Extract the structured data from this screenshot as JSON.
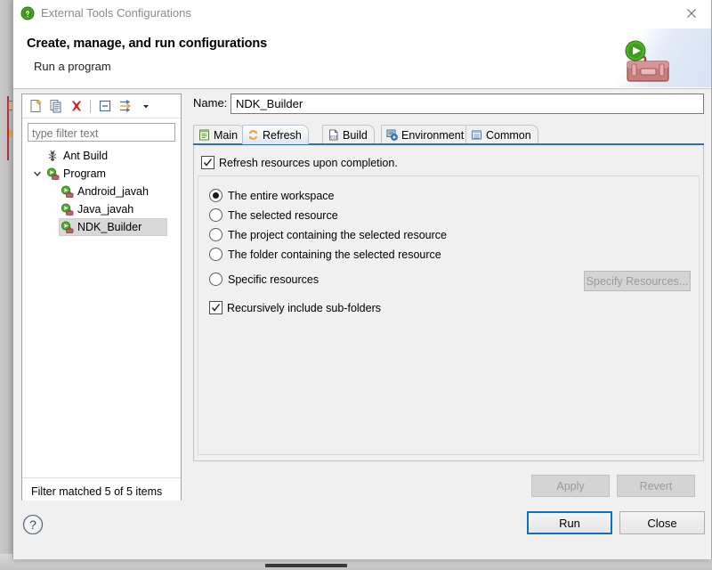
{
  "window": {
    "title": "External Tools Configurations",
    "title_icon": "eclipse-run-icon",
    "close_icon": "close-icon"
  },
  "header": {
    "title": "Create, manage, and run configurations",
    "subtitle": "Run a program",
    "art_icon": "toolbox-with-run-icon"
  },
  "left_panel": {
    "toolbar": [
      {
        "name": "new-configuration-icon",
        "tooltip": "New launch configuration"
      },
      {
        "name": "duplicate-configuration-icon",
        "tooltip": "Duplicate"
      },
      {
        "name": "delete-configuration-icon",
        "tooltip": "Delete"
      },
      {
        "name": "collapse-all-icon",
        "tooltip": "Collapse All"
      },
      {
        "name": "filter-icon",
        "tooltip": "Filter launch configurations"
      },
      {
        "name": "chevron-down-icon",
        "tooltip": "Menu"
      }
    ],
    "filter": {
      "value": "",
      "placeholder": "type filter text"
    },
    "tree": [
      {
        "label": "Ant Build",
        "level": 0,
        "icon": "ant-build-icon",
        "expandable": false,
        "expanded": false,
        "selected": false
      },
      {
        "label": "Program",
        "level": 0,
        "icon": "program-run-icon",
        "expandable": true,
        "expanded": true,
        "selected": false
      },
      {
        "label": "Android_javah",
        "level": 1,
        "icon": "program-run-icon",
        "expandable": false,
        "expanded": false,
        "selected": false
      },
      {
        "label": "Java_javah",
        "level": 1,
        "icon": "program-run-icon",
        "expandable": false,
        "expanded": false,
        "selected": false
      },
      {
        "label": "NDK_Builder",
        "level": 1,
        "icon": "program-run-icon",
        "expandable": false,
        "expanded": false,
        "selected": true
      }
    ],
    "status": "Filter matched 5 of 5 items"
  },
  "right_panel": {
    "name_label": "Name:",
    "name_value": "NDK_Builder",
    "tabs": [
      {
        "label": "Main",
        "icon": "main-tab-icon",
        "active": false
      },
      {
        "label": "Refresh",
        "icon": "refresh-tab-icon",
        "active": true
      },
      {
        "label": "Build",
        "icon": "build-tab-icon",
        "active": false
      },
      {
        "label": "Environment",
        "icon": "environment-tab-icon",
        "active": false
      },
      {
        "label": "Common",
        "icon": "common-tab-icon",
        "active": false
      }
    ],
    "refresh_tab": {
      "enable_checkbox": {
        "label": "Refresh resources upon completion.",
        "checked": true
      },
      "scope_options": [
        {
          "label": "The entire workspace",
          "selected": true
        },
        {
          "label": "The selected resource",
          "selected": false
        },
        {
          "label": "The project containing the selected resource",
          "selected": false
        },
        {
          "label": "The folder containing the selected resource",
          "selected": false
        },
        {
          "label": "Specific resources",
          "selected": false
        }
      ],
      "specify_button": {
        "label": "Specify Resources...",
        "enabled": false
      },
      "recursive_checkbox": {
        "label": "Recursively include sub-folders",
        "checked": true
      }
    },
    "apply_button": {
      "label": "Apply",
      "enabled": false
    },
    "revert_button": {
      "label": "Revert",
      "enabled": false
    }
  },
  "footer": {
    "help_icon": "help-question-icon",
    "run_button": {
      "label": "Run",
      "default": true
    },
    "close_button": {
      "label": "Close",
      "default": false
    }
  },
  "colors": {
    "accent_blue": "#0a72c4",
    "tab_underline": "#2f6db5",
    "delete_red": "#d02020",
    "run_green": "#34a032",
    "toolbox_red": "#b35a5a"
  }
}
